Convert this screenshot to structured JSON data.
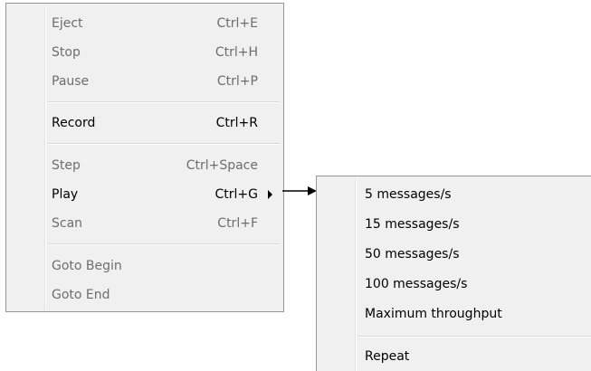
{
  "menu": {
    "items": [
      {
        "label": "Eject",
        "shortcut": "Ctrl+E",
        "enabled": false
      },
      {
        "label": "Stop",
        "shortcut": "Ctrl+H",
        "enabled": false
      },
      {
        "label": "Pause",
        "shortcut": "Ctrl+P",
        "enabled": false
      },
      {
        "label": "Record",
        "shortcut": "Ctrl+R",
        "enabled": true
      },
      {
        "label": "Step",
        "shortcut": "Ctrl+Space",
        "enabled": false
      },
      {
        "label": "Play",
        "shortcut": "Ctrl+G",
        "enabled": true,
        "has_submenu": true
      },
      {
        "label": "Scan",
        "shortcut": "Ctrl+F",
        "enabled": false
      },
      {
        "label": "Goto Begin",
        "shortcut": "",
        "enabled": false
      },
      {
        "label": "Goto End",
        "shortcut": "",
        "enabled": false
      }
    ]
  },
  "submenu": {
    "items": [
      {
        "label": "5 messages/s"
      },
      {
        "label": "15 messages/s"
      },
      {
        "label": "50 messages/s"
      },
      {
        "label": "100 messages/s"
      },
      {
        "label": "Maximum throughput"
      },
      {
        "label": "Repeat"
      }
    ]
  },
  "colors": {
    "menu_background": "#f0f0f0",
    "menu_border": "#979797",
    "enabled_text": "#000000",
    "disabled_text": "#6d6d6d"
  }
}
